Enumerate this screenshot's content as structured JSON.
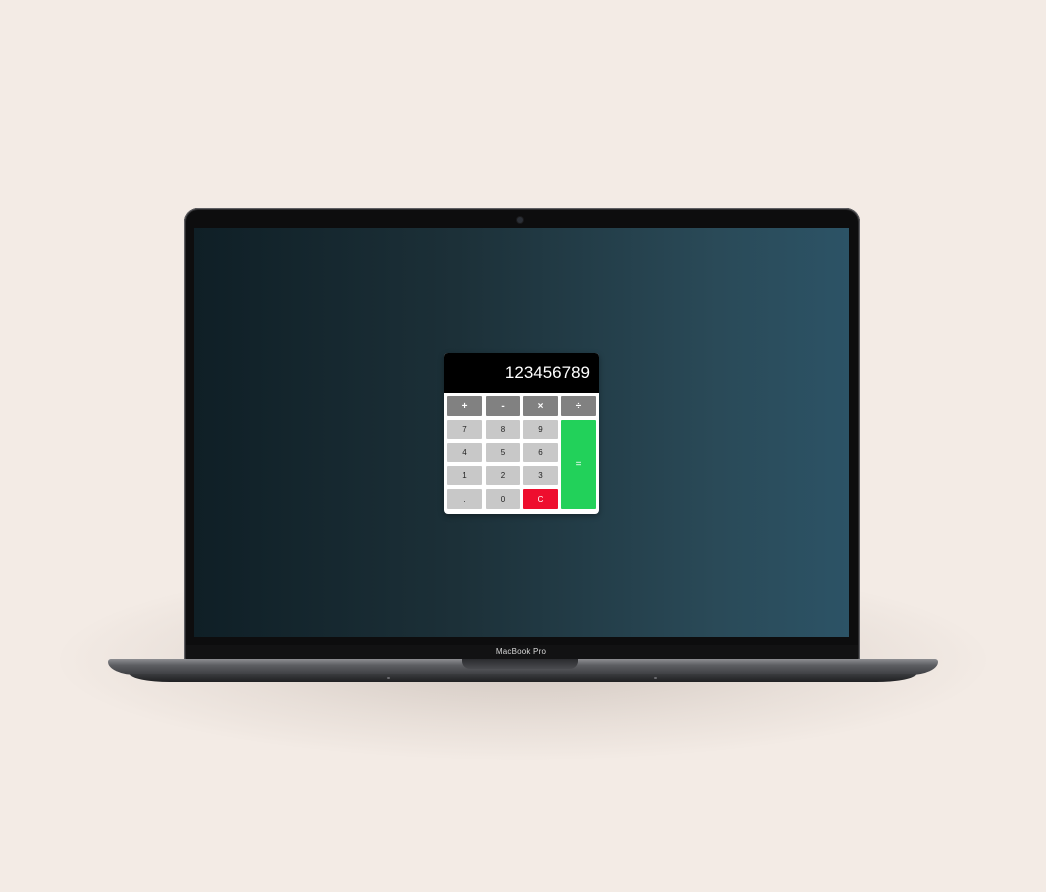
{
  "device": {
    "model_label": "MacBook Pro"
  },
  "calculator": {
    "display_value": "123456789",
    "operators": [
      "+",
      "-",
      "×",
      "÷"
    ],
    "rows": [
      [
        "7",
        "8",
        "9"
      ],
      [
        "4",
        "5",
        "6"
      ],
      [
        "1",
        "2",
        "3"
      ],
      [
        ".",
        "0",
        "C"
      ]
    ],
    "equals_label": "=",
    "colors": {
      "display_bg": "#000000",
      "operator_bg": "#818181",
      "number_bg": "#c8c8c8",
      "clear_bg": "#ee0e2e",
      "equals_bg": "#22d15a"
    }
  },
  "colors": {
    "background": "#f3ebe5",
    "screen_gradient_start": "#0f1f26",
    "screen_gradient_end": "#2c5366"
  }
}
